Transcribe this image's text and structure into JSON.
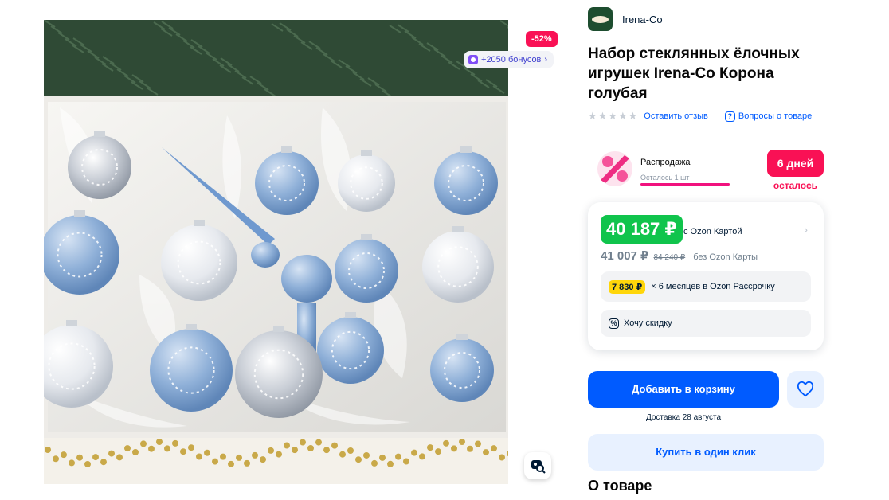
{
  "image": {
    "discount_badge": "-52%",
    "bonus_text": "+2050 бонусов"
  },
  "brand": {
    "name": "Irena-Co"
  },
  "product": {
    "title": "Набор стеклянных ёлочных игрушек Irena-Co Корона голубая",
    "rating_stars": 0,
    "review_link": "Оставить отзыв",
    "questions_link": "Вопросы о товаре"
  },
  "sale": {
    "title": "Распродажа",
    "remaining": "Осталось 1 шт",
    "days_badge": "6 дней",
    "days_sub": "осталось"
  },
  "price": {
    "card_price": "40 187 ₽",
    "card_label": "с Ozon Картой",
    "regular_price": "41 007 ₽",
    "old_price": "84 240 ₽",
    "regular_label": "без Ozon Карты",
    "installment_price": "7 830 ₽",
    "installment_text": "× 6 месяцев в Ozon Рассрочку",
    "want_discount": "Хочу скидку"
  },
  "actions": {
    "add_to_cart": "Добавить в корзину",
    "delivery": "Доставка 28 августа",
    "buy_one_click": "Купить в один клик"
  },
  "section": {
    "about": "О товаре"
  },
  "colors": {
    "primary_blue": "#005bff",
    "sale_pink": "#f91155",
    "ozon_card_green": "#10c44c",
    "installment_yellow": "#ffd60a"
  },
  "icons": [
    "bonus-coin-icon",
    "chevron-right-icon",
    "star-icon",
    "question-icon",
    "percent-icon",
    "discount-icon",
    "heart-icon",
    "image-search-icon"
  ]
}
